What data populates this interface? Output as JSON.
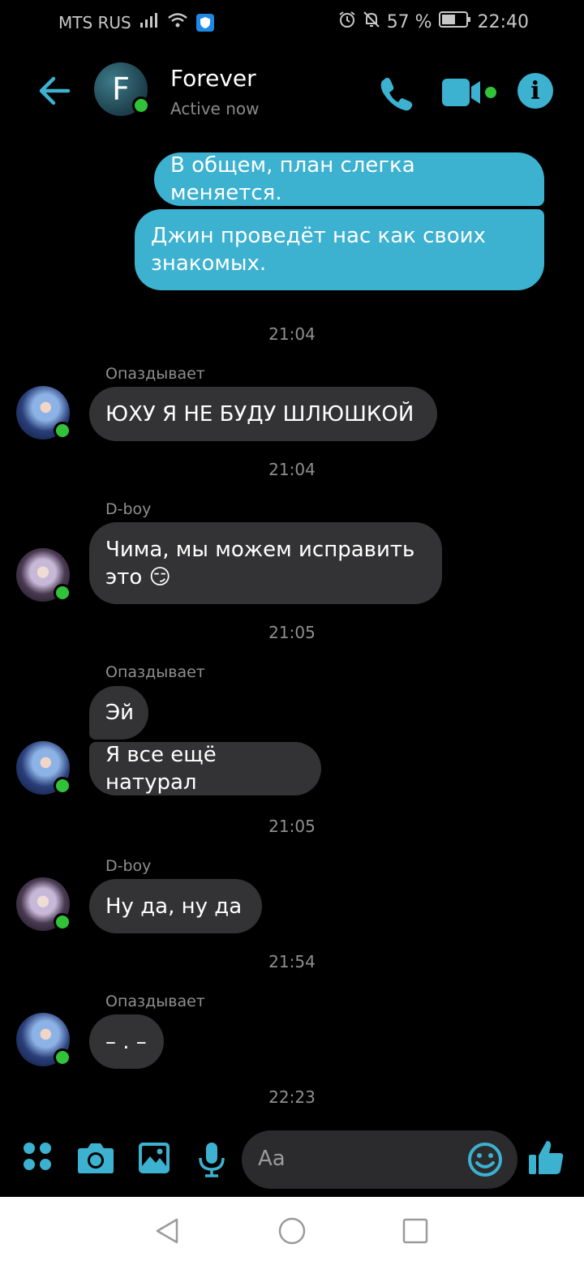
{
  "status_bar": {
    "carrier": "MTS RUS",
    "battery": "57 %",
    "time": "22:40"
  },
  "header": {
    "avatar_letter": "F",
    "name": "Forever",
    "status": "Active now"
  },
  "messages": {
    "out1": "В общем, план слегка меняется.",
    "out2_l1": "Джин проведёт нас как своих",
    "out2_l2": "знакомых.",
    "ts1": "21:04",
    "sender1": "Опаздывает",
    "in1": "ЮХУ Я НЕ БУДУ ШЛЮШКОЙ",
    "ts2": "21:04",
    "sender2": "D-boy",
    "in2_l1": "Чима, мы можем исправить",
    "in2_l2": "это 😏",
    "ts3": "21:05",
    "sender3": "Опаздывает",
    "in3a": "Эй",
    "in3b": "Я все ещё натурал",
    "ts4": "21:05",
    "sender4": "D-boy",
    "in4": "Ну да, ну да",
    "ts5": "21:54",
    "sender5": "Опаздывает",
    "in5": "– . –",
    "ts6": "22:23"
  },
  "composer": {
    "placeholder": "Aa"
  },
  "colors": {
    "accent": "#3cb1d0",
    "incoming_bubble": "#333335",
    "online": "#31c23a"
  }
}
